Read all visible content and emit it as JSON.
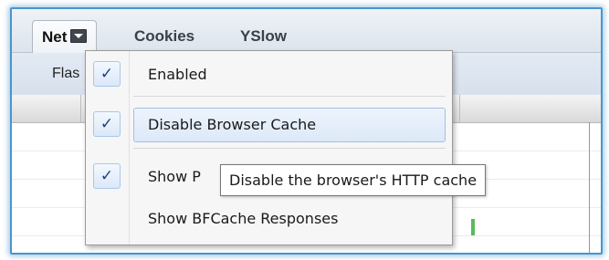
{
  "tabs": {
    "net": "Net",
    "cookies": "Cookies",
    "yslow": "YSlow"
  },
  "toolbar": {
    "partial_label": "Flas"
  },
  "menu": {
    "items": [
      {
        "label": "Enabled",
        "checked": true
      },
      {
        "label": "Disable Browser Cache",
        "checked": true,
        "highlighted": true
      },
      {
        "label": "Show P",
        "checked": true
      },
      {
        "label": "Show BFCache Responses",
        "checked": false
      }
    ],
    "check_glyph": "✓"
  },
  "tooltip": {
    "text": "Disable the browser's HTTP cache"
  },
  "icons": {
    "net_dropdown": "dropdown-arrow-icon",
    "checkmark": "checkmark-icon"
  },
  "colors": {
    "frame_border": "#4a95cc",
    "highlight": "#dde9f8",
    "check": "#1f3e86",
    "timing_bar": "#5cb85c",
    "timeline_line": "#8a8ee0"
  }
}
